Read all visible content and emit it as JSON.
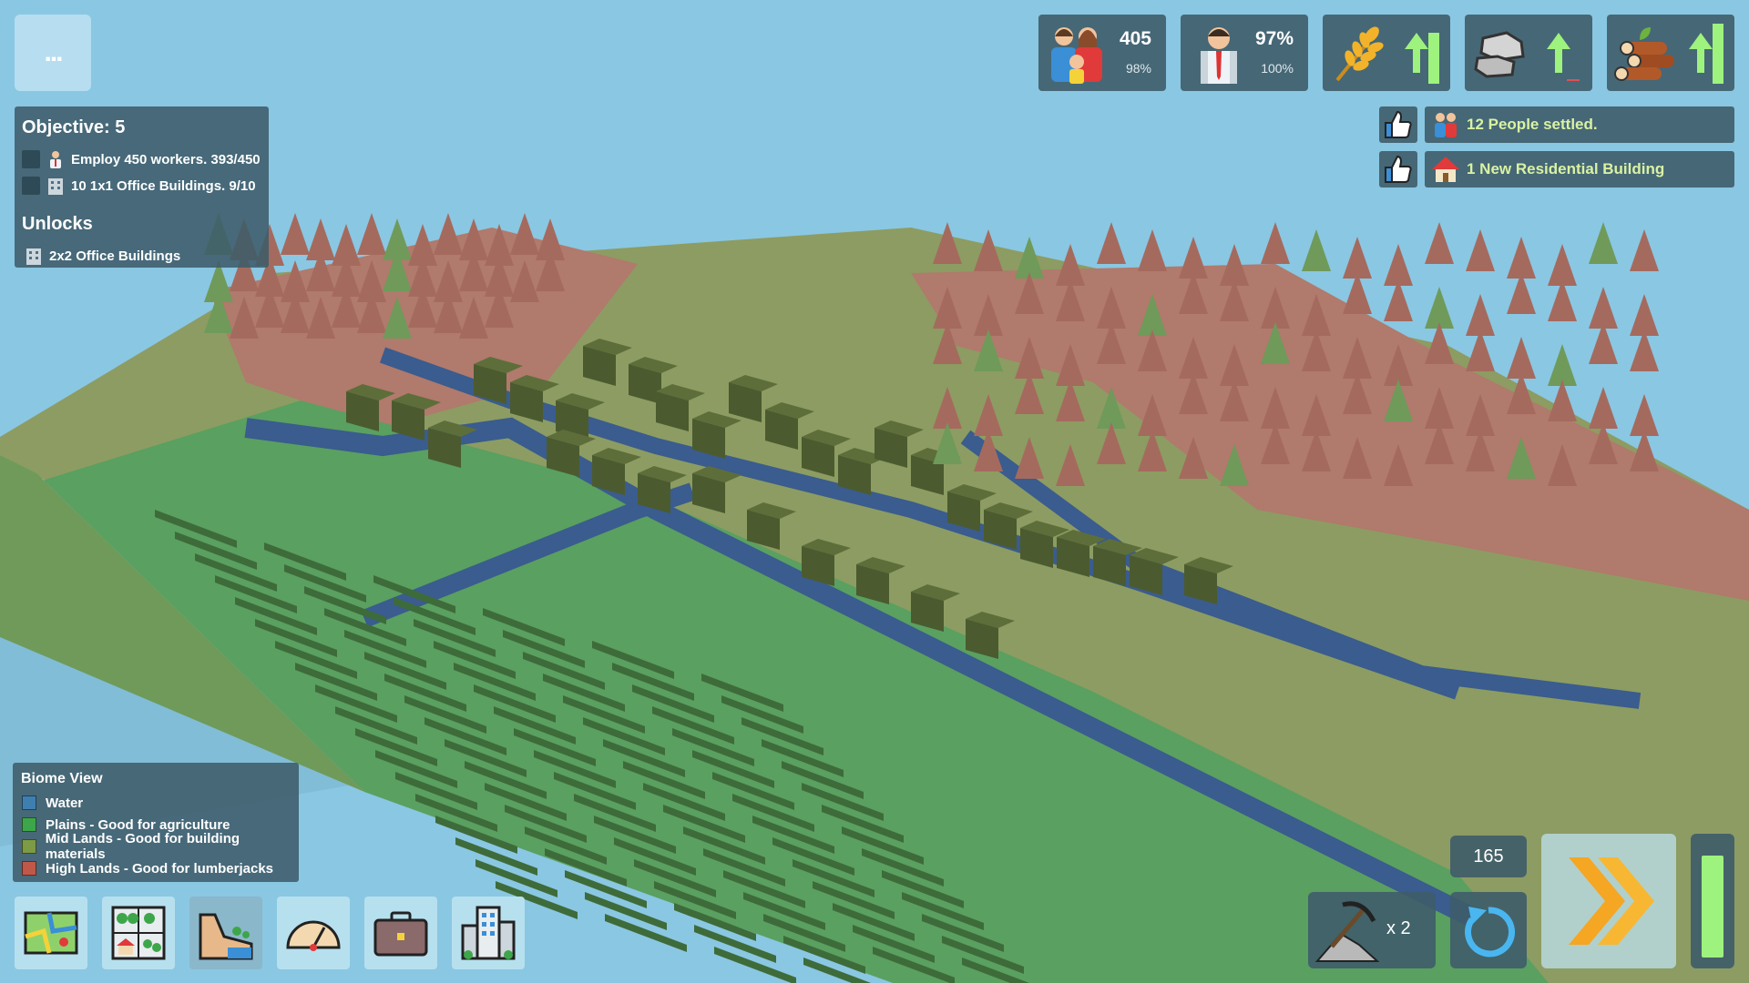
{
  "menu": {
    "label": "..."
  },
  "objective": {
    "title": "Objective: 5",
    "tasks": [
      {
        "text": "Employ 450 workers. 393/450",
        "icon": "worker-icon",
        "done": false
      },
      {
        "text": "10 1x1 Office Buildings. 9/10",
        "icon": "office-building-icon",
        "done": false
      }
    ],
    "unlocks_title": "Unlocks",
    "unlocks": [
      {
        "text": "2x2 Office Buildings",
        "icon": "office-building-icon"
      }
    ]
  },
  "stats": {
    "population": {
      "value": "405",
      "sub": "98%",
      "icon": "family-icon"
    },
    "employment": {
      "value": "97%",
      "sub": "100%",
      "icon": "worker-icon"
    },
    "food": {
      "icon": "wheat-icon",
      "trend": "up",
      "level": 0.85
    },
    "stone": {
      "icon": "stone-icon",
      "trend": "up",
      "level": 0.05
    },
    "wood": {
      "icon": "logs-icon",
      "trend": "up",
      "level": 0.85
    }
  },
  "notifications": [
    {
      "text": "12 People settled.",
      "icon": "people-icon"
    },
    {
      "text": "1 New Residential Building",
      "icon": "house-icon"
    }
  ],
  "biome": {
    "title": "Biome View",
    "legend": [
      {
        "label": "Water",
        "color": "#3f7fb0"
      },
      {
        "label": "Plains - Good for agriculture",
        "color": "#3ea64a"
      },
      {
        "label": "Mid Lands - Good for building materials",
        "color": "#7d9a45"
      },
      {
        "label": "High Lands - Good for lumberjacks",
        "color": "#c0584a"
      }
    ]
  },
  "toolbar": [
    {
      "name": "map-view-button",
      "icon": "map-icon",
      "selected": false
    },
    {
      "name": "zoning-button",
      "icon": "zoning-icon",
      "selected": false
    },
    {
      "name": "biome-view-button",
      "icon": "terrain-icon",
      "selected": true
    },
    {
      "name": "stats-gauge-button",
      "icon": "gauge-icon",
      "selected": false
    },
    {
      "name": "jobs-button",
      "icon": "briefcase-icon",
      "selected": false
    },
    {
      "name": "buildings-button",
      "icon": "city-icon",
      "selected": false
    }
  ],
  "controls": {
    "level_count": "165",
    "mine_multiplier": "x 2",
    "energy_level": 0.9
  },
  "colors": {
    "panel": "#3e5c6a",
    "accent_green": "#9ef27e",
    "sky": "#8ac7e2"
  }
}
